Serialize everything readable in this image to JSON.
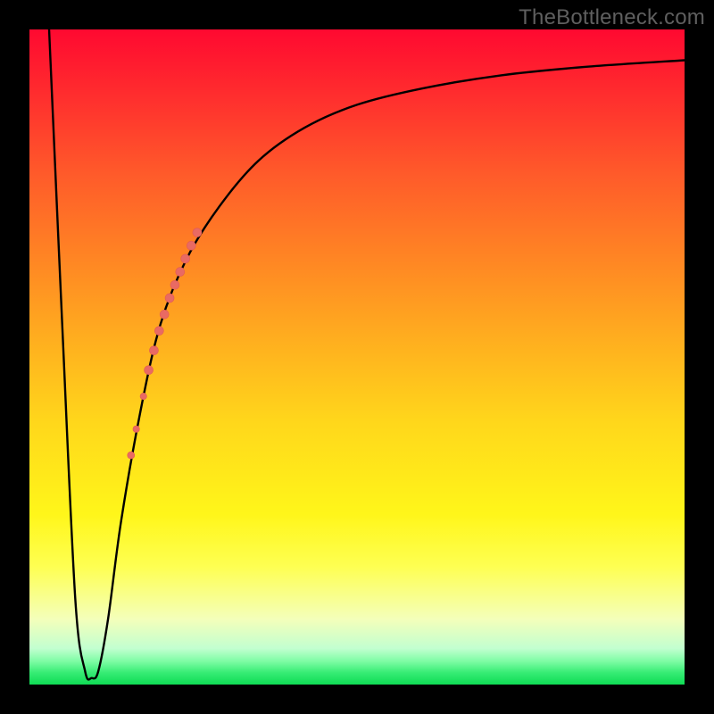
{
  "watermark": "TheBottleneck.com",
  "colors": {
    "curve": "#000000",
    "marker_fill": "#e96a63",
    "marker_stroke": "#e35b53"
  },
  "chart_data": {
    "type": "line",
    "title": "",
    "xlabel": "",
    "ylabel": "",
    "xlim": [
      0,
      100
    ],
    "ylim": [
      0,
      100
    ],
    "series": [
      {
        "name": "bottleneck-curve",
        "x": [
          3,
          5,
          7,
          8.5,
          9.5,
          10.5,
          12,
          14,
          17,
          20,
          24,
          29,
          35,
          42,
          50,
          60,
          72,
          85,
          100
        ],
        "y": [
          100,
          55,
          13,
          2,
          1,
          2,
          10,
          25,
          42,
          55,
          65,
          73,
          80,
          85,
          88.5,
          91,
          93,
          94.3,
          95.3
        ]
      }
    ],
    "markers": [
      {
        "x": 15.5,
        "y": 35,
        "r": 4.0
      },
      {
        "x": 16.3,
        "y": 39,
        "r": 3.7
      },
      {
        "x": 17.4,
        "y": 44,
        "r": 3.7
      },
      {
        "x": 18.2,
        "y": 48,
        "r": 5.0
      },
      {
        "x": 19.0,
        "y": 51,
        "r": 5.0
      },
      {
        "x": 19.8,
        "y": 54,
        "r": 5.0
      },
      {
        "x": 20.6,
        "y": 56.5,
        "r": 5.0
      },
      {
        "x": 21.4,
        "y": 59,
        "r": 5.0
      },
      {
        "x": 22.2,
        "y": 61,
        "r": 5.0
      },
      {
        "x": 23.0,
        "y": 63,
        "r": 5.0
      },
      {
        "x": 23.8,
        "y": 65,
        "r": 5.0
      },
      {
        "x": 24.7,
        "y": 67,
        "r": 5.0
      },
      {
        "x": 25.6,
        "y": 69,
        "r": 5.0
      }
    ]
  }
}
